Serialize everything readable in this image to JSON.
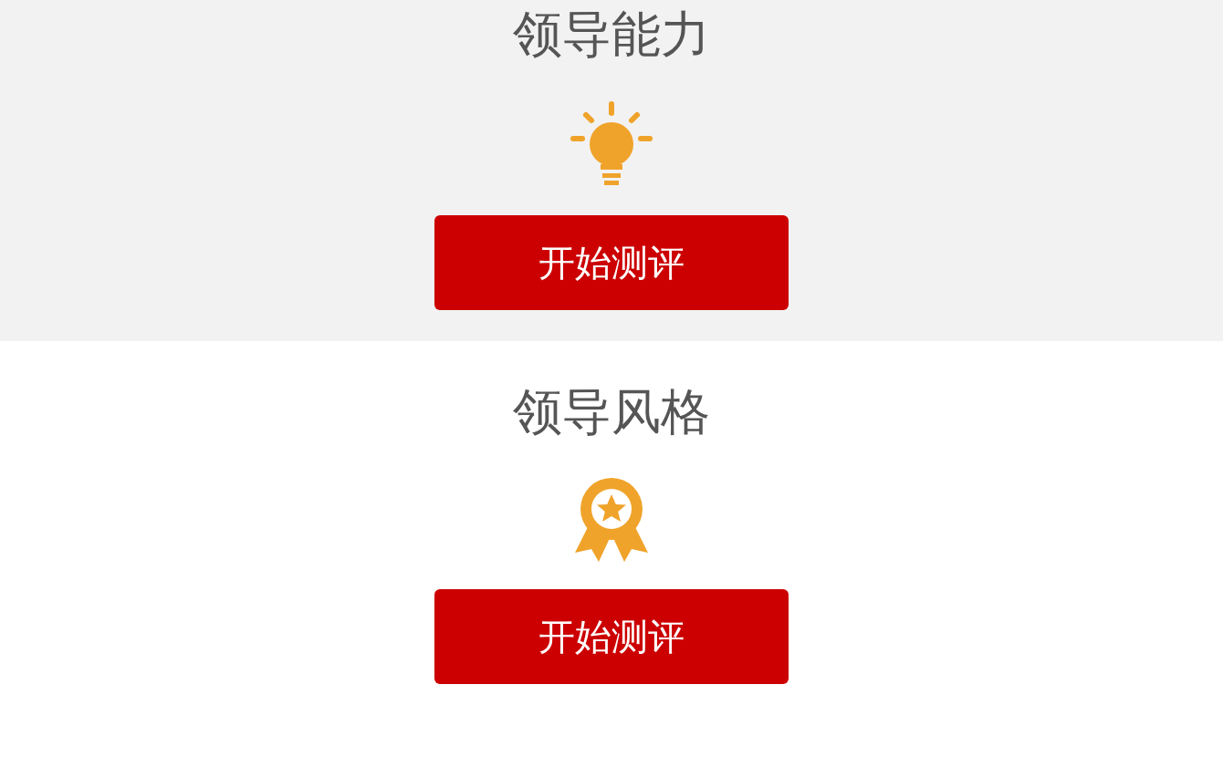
{
  "sections": [
    {
      "title": "领导能力",
      "kind": "bulb",
      "button": "开始测评",
      "shaded": true
    },
    {
      "title": "领导风格",
      "kind": "medal",
      "button": "开始测评",
      "shaded": false
    }
  ]
}
